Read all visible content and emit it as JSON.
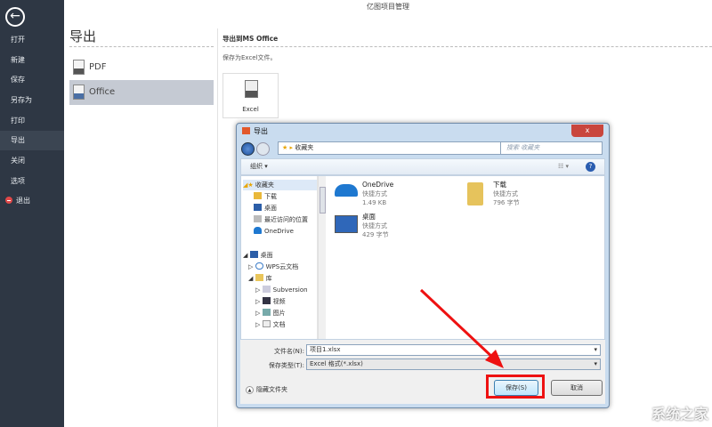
{
  "app_title": "亿图项目管理",
  "sidebar": {
    "items": [
      {
        "label": "打开"
      },
      {
        "label": "新建"
      },
      {
        "label": "保存"
      },
      {
        "label": "另存为"
      },
      {
        "label": "打印"
      },
      {
        "label": "导出"
      },
      {
        "label": "关闭"
      },
      {
        "label": "选项"
      },
      {
        "label": "退出"
      }
    ]
  },
  "export": {
    "heading": "导出",
    "options": [
      {
        "label": "PDF"
      },
      {
        "label": "Office"
      }
    ],
    "section_title": "导出到MS Office",
    "description": "保存为Excel文件。",
    "card_label": "Excel"
  },
  "dialog": {
    "title": "导出",
    "close": "x",
    "address": "收藏夹",
    "search_placeholder": "搜索 收藏夹",
    "organize": "组织 ▾",
    "nav": [
      {
        "label": "收藏夹"
      },
      {
        "label": "下载"
      },
      {
        "label": "桌面"
      },
      {
        "label": "最近访问的位置"
      },
      {
        "label": "OneDrive"
      },
      {
        "label": "桌面"
      },
      {
        "label": "WPS云文档"
      },
      {
        "label": "库"
      },
      {
        "label": "Subversion"
      },
      {
        "label": "视频"
      },
      {
        "label": "图片"
      },
      {
        "label": "文档"
      }
    ],
    "files": [
      {
        "name": "OneDrive",
        "type": "快捷方式",
        "size": "1.49 KB"
      },
      {
        "name": "下载",
        "type": "快捷方式",
        "size": "796 字节"
      },
      {
        "name": "桌面",
        "type": "快捷方式",
        "size": "429 字节"
      }
    ],
    "filename_label": "文件名(N):",
    "filename": "项目1.xlsx",
    "filetype_label": "保存类型(T):",
    "filetype": "Excel 格式(*.xlsx)",
    "hide_folders": "隐藏文件夹",
    "save": "保存(S)",
    "cancel": "取消"
  },
  "watermark": "系统之家"
}
